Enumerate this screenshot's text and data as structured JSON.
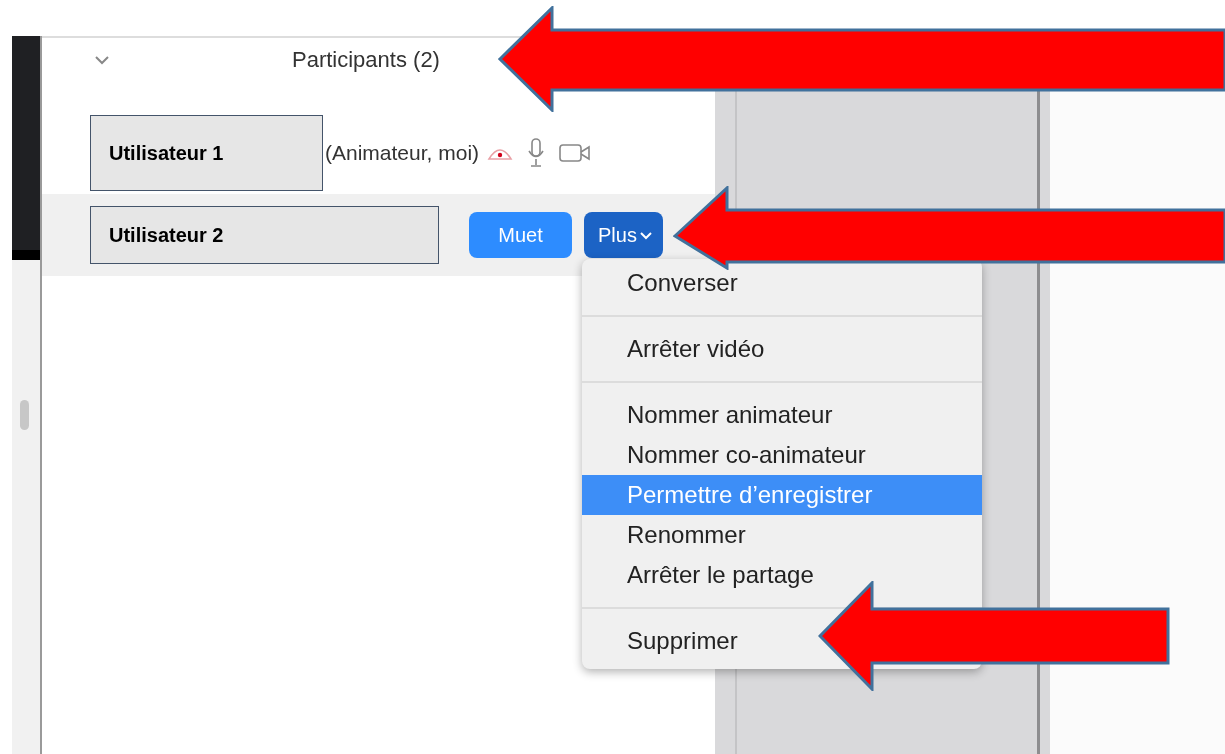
{
  "panel": {
    "title": "Participants (2)"
  },
  "participants": [
    {
      "name": "Utilisateur 1",
      "role": "(Animateur, moi)",
      "highlighted": false
    },
    {
      "name": "Utilisateur 2",
      "buttons": [
        {
          "label": "Muet",
          "kind": "plain"
        },
        {
          "label": "Plus",
          "kind": "dropdown"
        }
      ],
      "highlighted": true
    }
  ],
  "menu": {
    "groups": [
      [
        {
          "label": "Converser",
          "selected": false
        }
      ],
      [
        {
          "label": "Arrêter vidéo",
          "selected": false
        }
      ],
      [
        {
          "label": "Nommer animateur",
          "selected": false
        },
        {
          "label": "Nommer co-animateur",
          "selected": false
        },
        {
          "label": "Permettre d’enregistrer",
          "selected": true
        },
        {
          "label": "Renommer",
          "selected": false
        },
        {
          "label": "Arrêter le partage",
          "selected": false
        }
      ],
      [
        {
          "label": "Supprimer",
          "selected": false
        }
      ]
    ]
  }
}
